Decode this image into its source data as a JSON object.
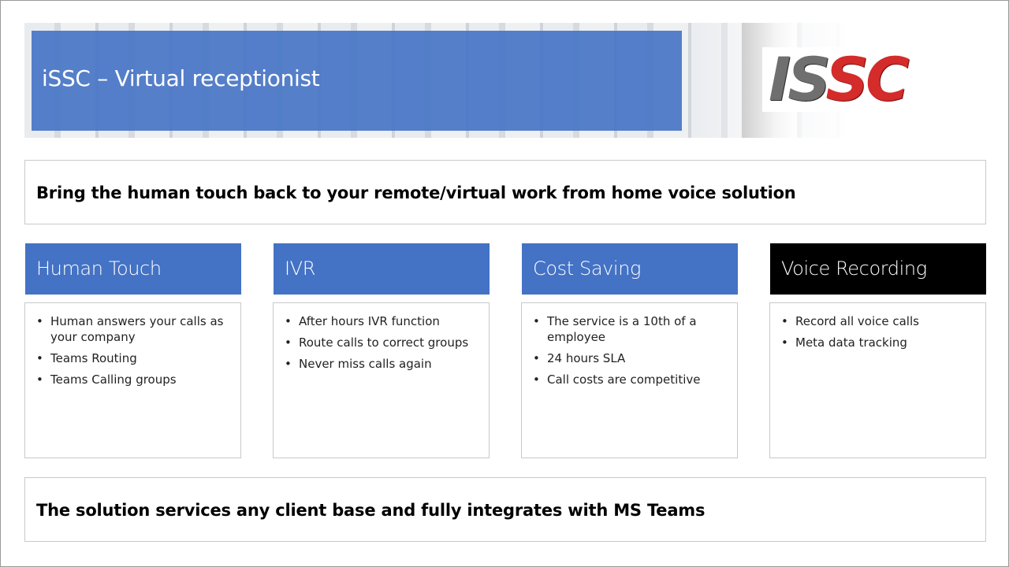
{
  "header": {
    "title": "iSSC – Virtual receptionist",
    "logo_text": "iSSC"
  },
  "tagline": "Bring the human touch back to your remote/virtual work from home voice solution",
  "columns": [
    {
      "title": "Human Touch",
      "items": [
        "Human answers your calls as your company",
        "Teams Routing",
        "Teams Calling groups"
      ]
    },
    {
      "title": "IVR",
      "items": [
        "After hours IVR function",
        "Route calls to correct groups",
        "Never miss calls again"
      ]
    },
    {
      "title": "Cost Saving",
      "items": [
        "The service is a 10th of a employee",
        "24 hours SLA",
        "Call costs are competitive"
      ]
    },
    {
      "title": "Voice Recording",
      "items": [
        "Record all voice calls",
        "Meta data tracking"
      ]
    }
  ],
  "footer": "The solution services any client base and fully integrates with MS Teams",
  "colors": {
    "accent_blue": "#4472c4",
    "logo_red": "#d42b2b",
    "logo_gray": "#6f6f6f",
    "dark_header": "#000000"
  }
}
